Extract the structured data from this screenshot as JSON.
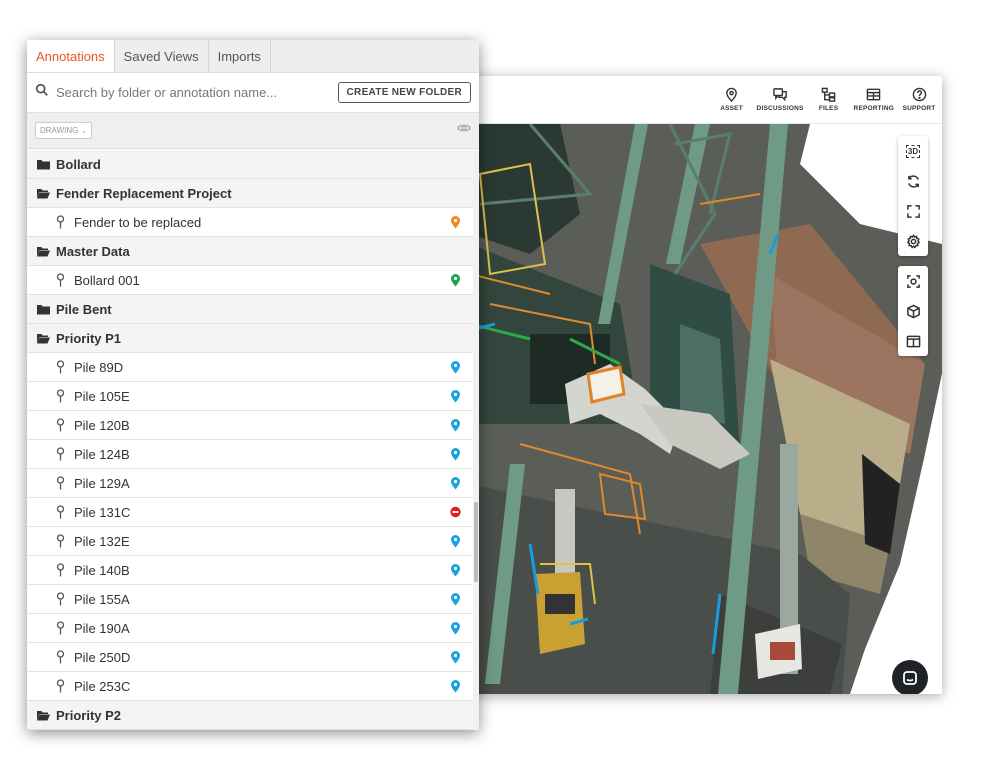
{
  "tabs": [
    {
      "label": "Annotations",
      "active": true
    },
    {
      "label": "Saved Views",
      "active": false
    },
    {
      "label": "Imports",
      "active": false
    }
  ],
  "search": {
    "placeholder": "Search by folder or annotation name..."
  },
  "create_button": "CREATE NEW FOLDER",
  "filter": {
    "selected": "DRAWING"
  },
  "topnav": [
    {
      "label": "ASSET",
      "icon": "location-pin-icon"
    },
    {
      "label": "DISCUSSIONS",
      "icon": "discussions-icon"
    },
    {
      "label": "FILES",
      "icon": "files-icon"
    },
    {
      "label": "REPORTING",
      "icon": "reporting-icon"
    },
    {
      "label": "SUPPORT",
      "icon": "help-icon"
    }
  ],
  "toolbar": {
    "three_d_label": "3D",
    "tools_top": [
      "3d-view-icon",
      "rotate-icon",
      "fullscreen-icon",
      "settings-icon"
    ],
    "tools_bottom": [
      "focus-icon",
      "cube-icon",
      "split-view-icon"
    ]
  },
  "colors": {
    "accent": "#e8542a",
    "marker_blue": "#1aa3e0",
    "marker_orange": "#f0881e",
    "marker_green": "#1aa64a",
    "marker_red": "#e02020"
  },
  "tree": [
    {
      "type": "folder",
      "label": "Bollard",
      "open": false
    },
    {
      "type": "folder",
      "label": "Fender Replacement Project",
      "open": true
    },
    {
      "type": "item",
      "label": "Fender to be replaced",
      "marker": "orange"
    },
    {
      "type": "folder",
      "label": "Master Data",
      "open": true
    },
    {
      "type": "item",
      "label": "Bollard 001",
      "marker": "green"
    },
    {
      "type": "folder",
      "label": "Pile Bent",
      "open": false
    },
    {
      "type": "folder",
      "label": "Priority P1",
      "open": true
    },
    {
      "type": "item",
      "label": "Pile 89D",
      "marker": "blue"
    },
    {
      "type": "item",
      "label": "Pile 105E",
      "marker": "blue"
    },
    {
      "type": "item",
      "label": "Pile 120B",
      "marker": "blue"
    },
    {
      "type": "item",
      "label": "Pile 124B",
      "marker": "blue"
    },
    {
      "type": "item",
      "label": "Pile 129A",
      "marker": "blue"
    },
    {
      "type": "item",
      "label": "Pile 131C",
      "marker": "red"
    },
    {
      "type": "item",
      "label": "Pile 132E",
      "marker": "blue"
    },
    {
      "type": "item",
      "label": "Pile 140B",
      "marker": "blue"
    },
    {
      "type": "item",
      "label": "Pile 155A",
      "marker": "blue"
    },
    {
      "type": "item",
      "label": "Pile 190A",
      "marker": "blue"
    },
    {
      "type": "item",
      "label": "Pile 250D",
      "marker": "blue"
    },
    {
      "type": "item",
      "label": "Pile 253C",
      "marker": "blue"
    },
    {
      "type": "folder",
      "label": "Priority P2",
      "open": true
    }
  ]
}
